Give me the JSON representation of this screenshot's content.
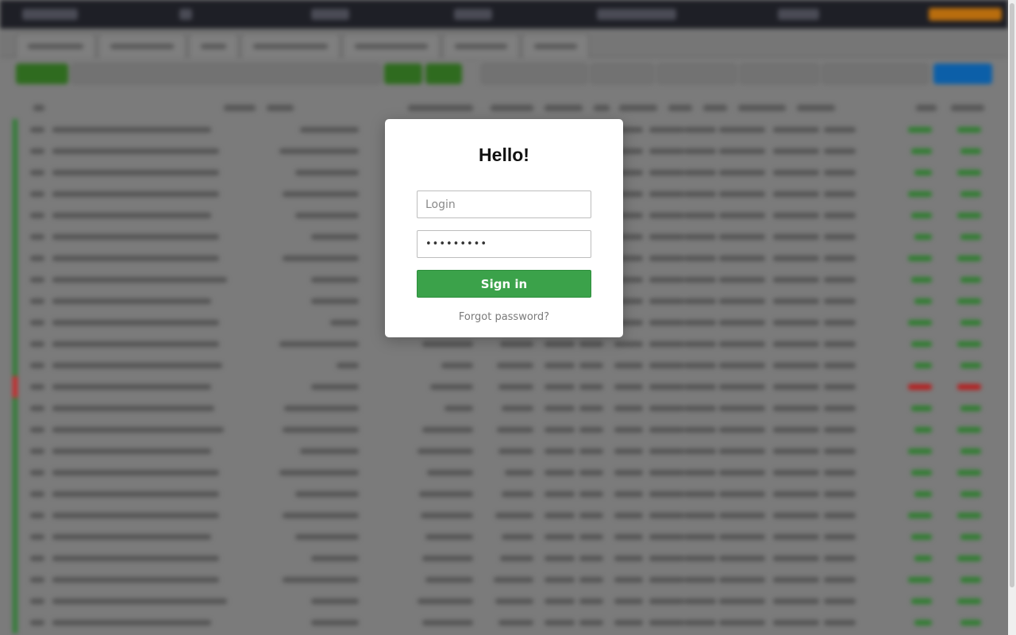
{
  "modal": {
    "title": "Hello!",
    "login_placeholder": "Login",
    "password_value": "password1",
    "sign_in_label": "Sign in",
    "forgot_label": "Forgot password?"
  },
  "colors": {
    "sign_in": "#3ba24a",
    "overlay": "#7b7b7b",
    "topbar": "#1e1f26"
  }
}
